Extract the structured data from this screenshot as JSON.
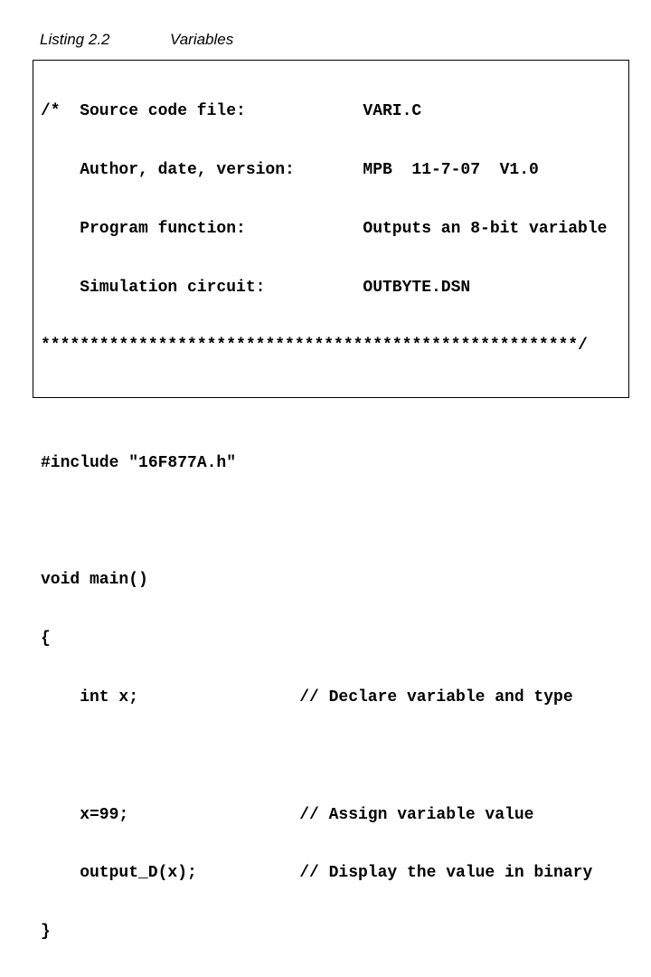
{
  "caption": {
    "number": "Listing 2.2",
    "title": "Variables"
  },
  "header_comment": {
    "open": "/*",
    "rows": [
      {
        "label": "Source code file:",
        "value": "VARI.C"
      },
      {
        "label": "Author, date, version:",
        "value": "MPB  11-7-07  V1.0"
      },
      {
        "label": "Program function:",
        "value": "Outputs an 8-bit variable"
      },
      {
        "label": "Simulation circuit:",
        "value": "OUTBYTE.DSN"
      }
    ],
    "close": "*******************************************************/"
  },
  "code": {
    "include": "#include \"16F877A.h\"",
    "main_signature": "void main()",
    "open_brace": "{",
    "statements": [
      {
        "code": "int x;",
        "comment": "// Declare variable and type"
      },
      {
        "code": "x=99;",
        "comment": "// Assign variable value"
      },
      {
        "code": "output_D(x);",
        "comment": "// Display the value in binary"
      }
    ],
    "close_brace": "}"
  }
}
